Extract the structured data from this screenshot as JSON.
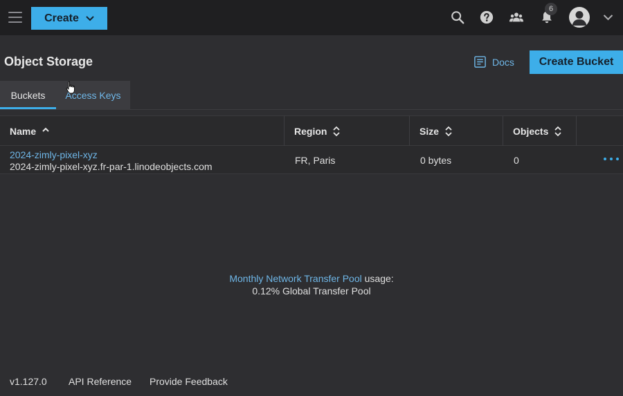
{
  "topbar": {
    "create_label": "Create",
    "notification_count": "6"
  },
  "icons": [
    "menu-icon",
    "chevron-down-icon",
    "search-icon",
    "help-icon",
    "community-icon",
    "bell-icon",
    "user-icon",
    "docs-icon",
    "sort-icon",
    "more-icon"
  ],
  "header": {
    "title": "Object Storage",
    "docs_label": "Docs",
    "create_bucket_label": "Create Bucket"
  },
  "tabs": [
    {
      "label": "Buckets",
      "active": true
    },
    {
      "label": "Access Keys",
      "active": false
    }
  ],
  "table": {
    "columns": [
      "Name",
      "Region",
      "Size",
      "Objects"
    ],
    "rows": [
      {
        "name": "2024-zimly-pixel-xyz",
        "hostname": "2024-zimly-pixel-xyz.fr-par-1.linodeobjects.com",
        "region": "FR, Paris",
        "size": "0 bytes",
        "objects": "0"
      }
    ]
  },
  "transfer": {
    "link_label": "Monthly Network Transfer Pool",
    "suffix": " usage:",
    "usage_text": "0.12% Global Transfer Pool"
  },
  "footer": {
    "version": "v1.127.0",
    "api_reference": "API Reference",
    "feedback": "Provide Feedback"
  },
  "colors": {
    "accent": "#3daee9",
    "link": "#6fb7e8",
    "background": "#2e2e31",
    "topbar": "#1f1f21"
  }
}
